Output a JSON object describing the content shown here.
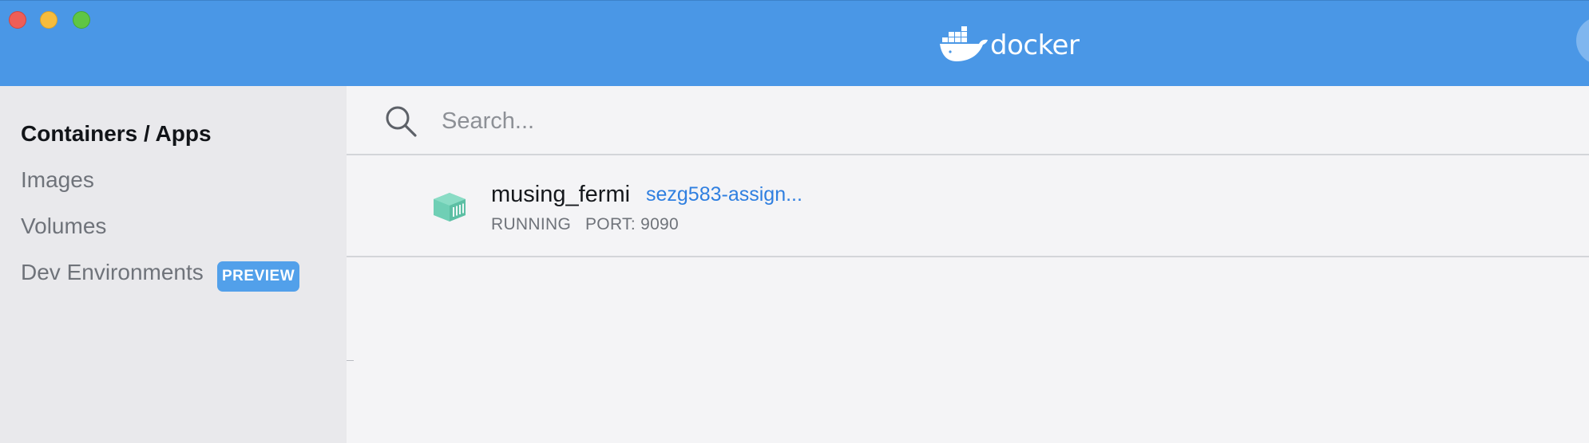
{
  "window": {
    "brand": "docker",
    "logo_icon": "docker-whale-icon",
    "window_controls": [
      "close",
      "minimize",
      "maximize"
    ],
    "colors": {
      "header": "#4a97e6",
      "sidebar": "#e9e9ec",
      "content": "#f4f4f6",
      "accent": "#2f7fe0",
      "badge": "#52a0ea",
      "container_icon": "#6fcfb5"
    }
  },
  "sidebar": {
    "items": [
      {
        "label": "Containers / Apps",
        "active": true
      },
      {
        "label": "Images",
        "active": false
      },
      {
        "label": "Volumes",
        "active": false
      },
      {
        "label": "Dev Environments",
        "active": false,
        "badge": "PREVIEW"
      }
    ]
  },
  "search": {
    "placeholder": "Search...",
    "value": "",
    "icon": "search-icon"
  },
  "containers": [
    {
      "name": "musing_fermi",
      "image_link": "sezg583-assign...",
      "status": "RUNNING",
      "port": "PORT: 9090",
      "icon": "container-icon"
    }
  ]
}
